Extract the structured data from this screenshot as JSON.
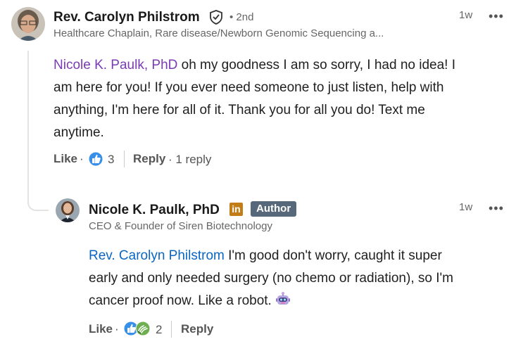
{
  "comment": {
    "author_name": "Rev. Carolyn Philstrom",
    "degree": "• 2nd",
    "headline": "Healthcare Chaplain, Rare disease/Newborn Genomic Sequencing a...",
    "time": "1w",
    "more_label": "•••",
    "mention": "Nicole K. Paulk, PhD",
    "text_line1": " oh my goodness I am so sorry, I had no idea! I",
    "text_line2": "am here for you! If you ever need someone to just listen, help with",
    "text_line3": "anything, I'm here for all of it. Thank you for all you do! Text me",
    "text_line4": "anytime.",
    "like_label": "Like",
    "dot": "·",
    "reaction_count": "3",
    "reply_label": "Reply",
    "replies_text": "· 1 reply"
  },
  "reply": {
    "author_name": "Nicole K. Paulk, PhD",
    "linkedin_badge": "in",
    "author_badge": "Author",
    "headline": "CEO & Founder of Siren Biotechnology",
    "time": "1w",
    "more_label": "•••",
    "mention": "Rev. Carolyn Philstrom",
    "text_line1": " I'm good don't worry, caught it super",
    "text_line2": "early and only needed surgery (no chemo or radiation), so I'm",
    "text_line3": "cancer proof now. Like a robot. ",
    "emoji_name": "robot-emoji",
    "like_label": "Like",
    "dot": "·",
    "reaction_count": "2",
    "reply_label": "Reply"
  },
  "colors": {
    "mention_purple": "#7b3ab5",
    "mention_blue": "#0a66c2",
    "like_blue": "#378fe9",
    "support_green": "#44712e",
    "author_badge_bg": "#56687a"
  }
}
